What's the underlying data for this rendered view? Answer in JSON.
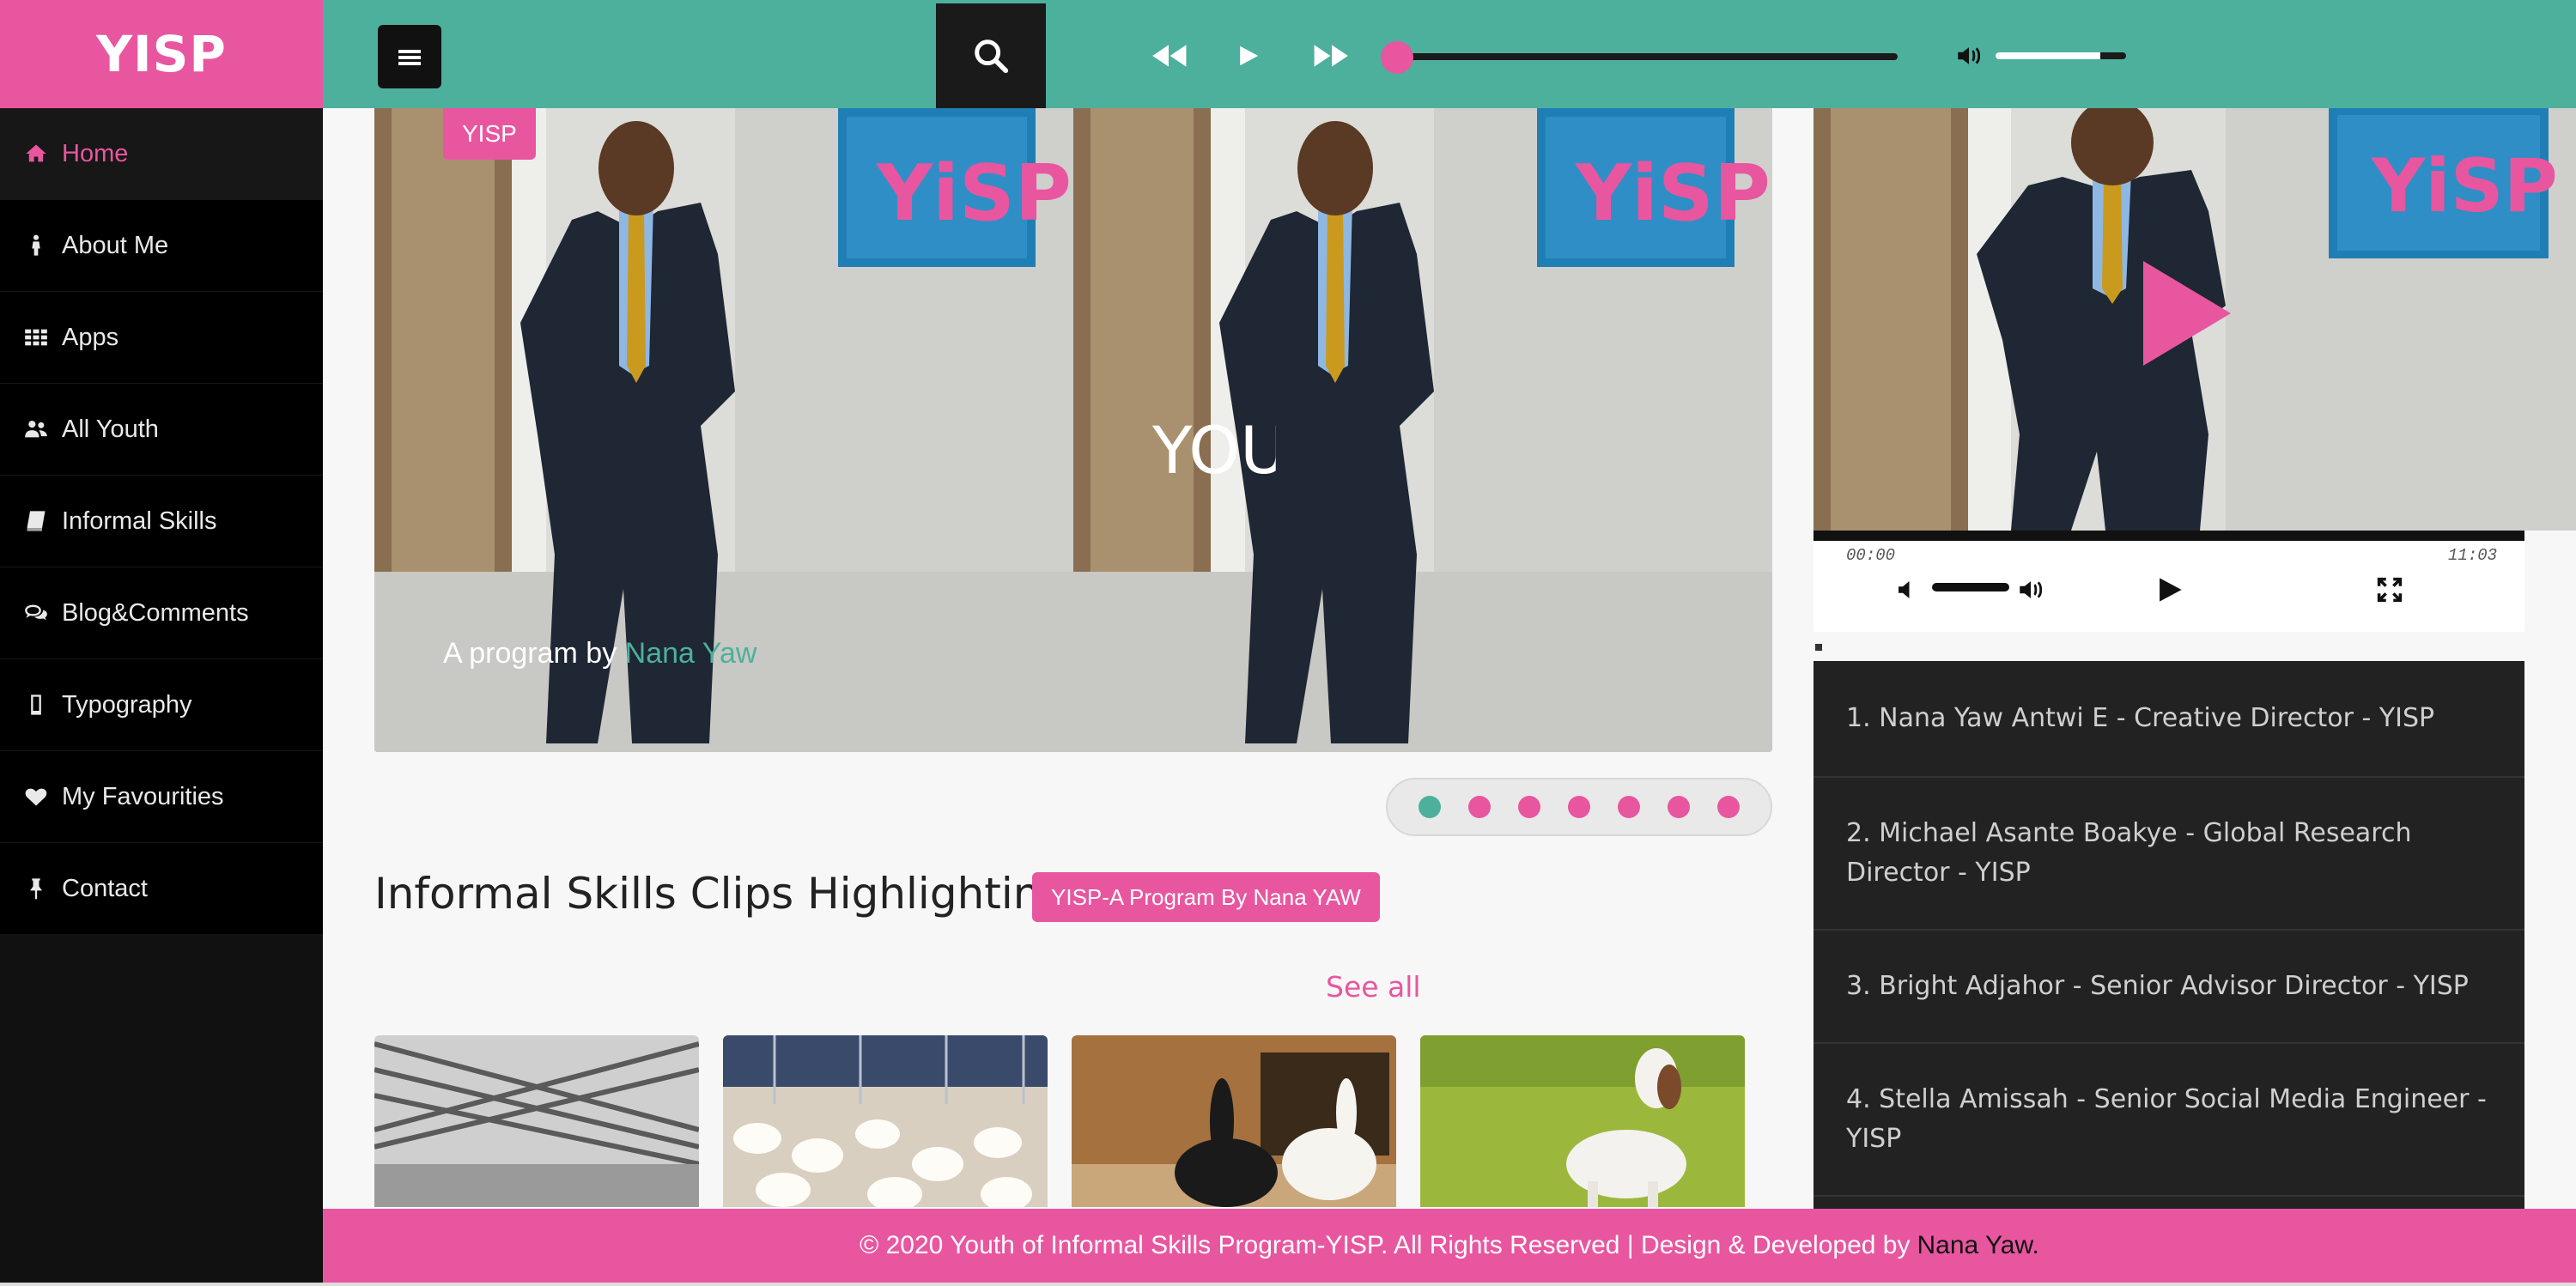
{
  "brand": {
    "logo": "YISP",
    "accent": "#e8569f",
    "teal": "#4db09c"
  },
  "sidebar": {
    "items": [
      {
        "label": "Home",
        "icon": "home-icon",
        "active": true
      },
      {
        "label": "About Me",
        "icon": "person-icon"
      },
      {
        "label": "Apps",
        "icon": "grid-icon"
      },
      {
        "label": "All Youth",
        "icon": "users-icon"
      },
      {
        "label": "Informal Skills",
        "icon": "book-icon"
      },
      {
        "label": "Blog&Comments",
        "icon": "comments-icon"
      },
      {
        "label": "Typography",
        "icon": "mobile-icon"
      },
      {
        "label": "My Favourities",
        "icon": "heart-icon"
      },
      {
        "label": "Contact",
        "icon": "pin-icon"
      }
    ]
  },
  "player": {
    "progress": 0.0,
    "volume": 0.8
  },
  "slider": {
    "badge": "YISP",
    "caption_prefix": "A program by",
    "caption_name": "Nana Yaw",
    "overlay_word": "YOU",
    "dots": 7,
    "active_dot": 0
  },
  "section": {
    "title": "Informal Skills Clips Highlighting",
    "tag": "YISP-A Program By Nana YAW",
    "see_all": "See all"
  },
  "video": {
    "current_time": "00:00",
    "duration": "11:03"
  },
  "team": [
    "1. Nana Yaw Antwi E - Creative Director - YISP",
    "2. Michael Asante Boakye - Global Research Director - YISP",
    "3. Bright Adjahor - Senior Advisor Director - YISP",
    "4. Stella Amissah - Senior Social Media Engineer - YISP"
  ],
  "footer": {
    "text": "© 2020 Youth of Informal Skills Program-YISP. All Rights Reserved | Design & Developed by",
    "developer": "Nana Yaw."
  }
}
